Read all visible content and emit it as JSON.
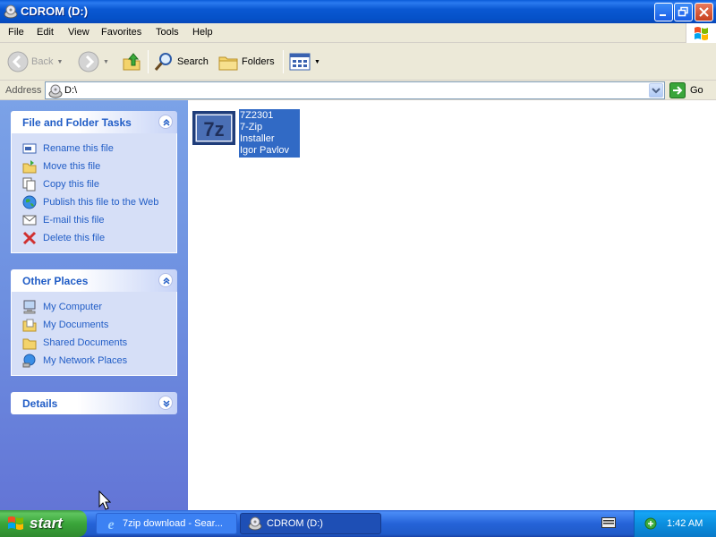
{
  "window": {
    "title": "CDROM (D:)"
  },
  "menu": [
    "File",
    "Edit",
    "View",
    "Favorites",
    "Tools",
    "Help"
  ],
  "toolbar": {
    "back_label": "Back",
    "search_label": "Search",
    "folders_label": "Folders"
  },
  "address": {
    "label": "Address",
    "value": "D:\\",
    "go_label": "Go"
  },
  "tasks_panel": {
    "title": "File and Folder Tasks",
    "items": [
      {
        "label": "Rename this file",
        "icon": "rename-icon"
      },
      {
        "label": "Move this file",
        "icon": "move-icon"
      },
      {
        "label": "Copy this file",
        "icon": "copy-icon"
      },
      {
        "label": "Publish this file to the Web",
        "icon": "globe-icon"
      },
      {
        "label": "E-mail this file",
        "icon": "email-icon"
      },
      {
        "label": "Delete this file",
        "icon": "delete-x-icon"
      }
    ]
  },
  "places_panel": {
    "title": "Other Places",
    "items": [
      {
        "label": "My Computer",
        "icon": "computer-icon"
      },
      {
        "label": "My Documents",
        "icon": "documents-folder-icon"
      },
      {
        "label": "Shared Documents",
        "icon": "shared-folder-icon"
      },
      {
        "label": "My Network Places",
        "icon": "network-icon"
      }
    ]
  },
  "details_panel": {
    "title": "Details"
  },
  "file": {
    "name": "7Z2301",
    "description": "7-Zip Installer",
    "author": "Igor Pavlov",
    "icon_text": "7z"
  },
  "taskbar": {
    "start_label": "start",
    "buttons": [
      {
        "label": "7zip download - Sear..."
      },
      {
        "label": "CDROM (D:)"
      }
    ],
    "clock": "1:42 AM"
  },
  "colors": {
    "titlebar": "#0a58d2",
    "link": "#215dc6",
    "selection": "#316ac5",
    "start": "#3aa53a"
  }
}
